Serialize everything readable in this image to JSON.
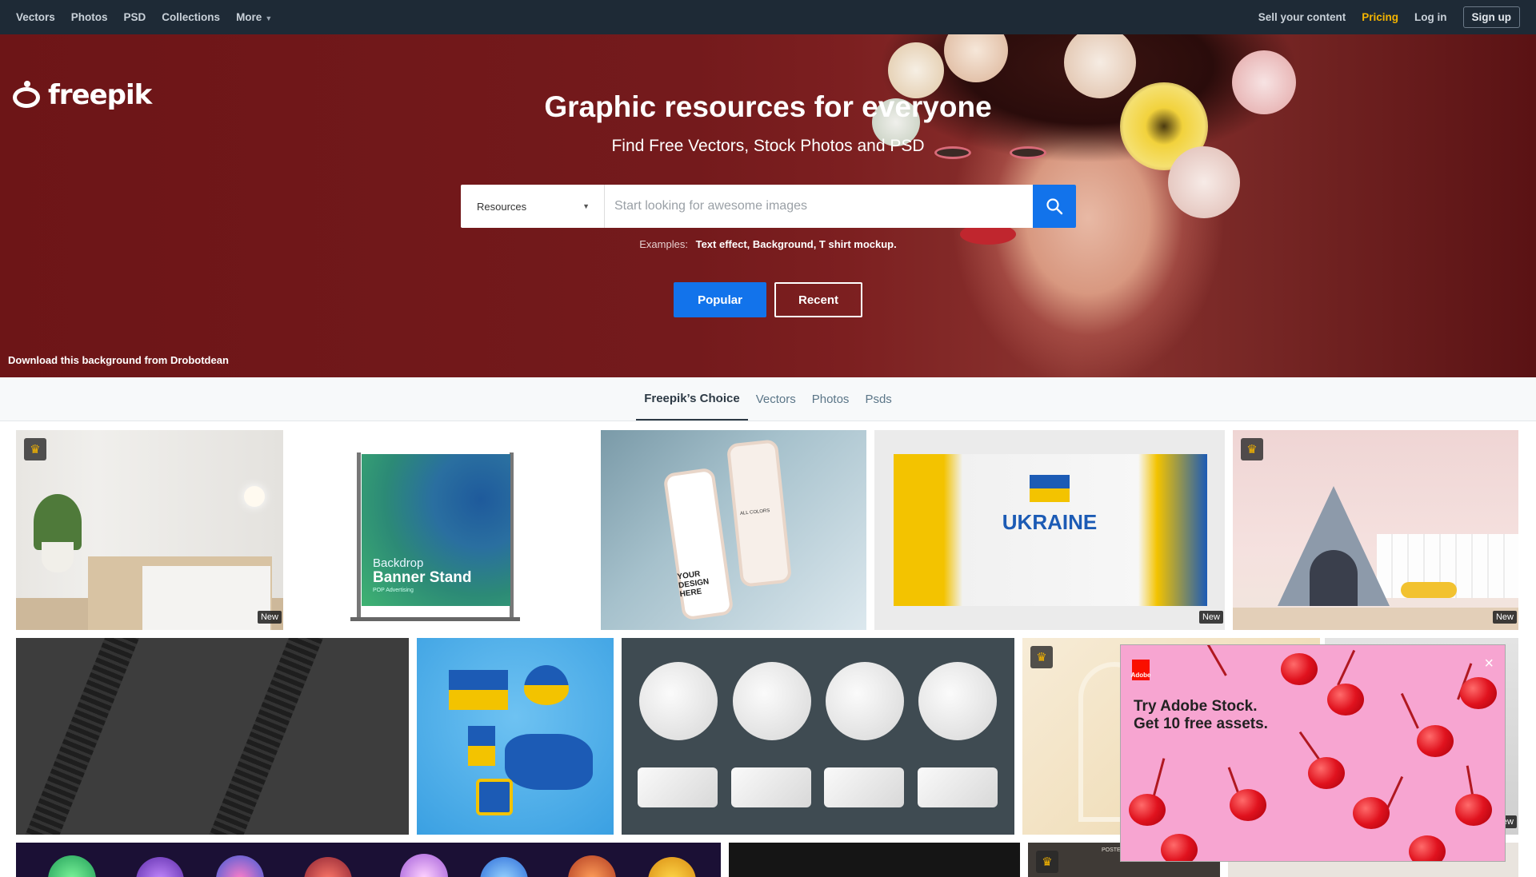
{
  "nav": {
    "left": [
      "Vectors",
      "Photos",
      "PSD",
      "Collections",
      "More"
    ],
    "sell": "Sell your content",
    "pricing": "Pricing",
    "login": "Log in",
    "signup": "Sign up"
  },
  "logo": {
    "text": "freepik"
  },
  "hero": {
    "title": "Graphic resources for everyone",
    "subtitle": "Find Free Vectors, Stock Photos and PSD",
    "search_type": "Resources",
    "search_placeholder": "Start looking for awesome images",
    "examples_label": "Examples:",
    "examples": "Text effect, Background, T shirt mockup.",
    "popular": "Popular",
    "recent": "Recent",
    "credit": "Download this background from Drobotdean"
  },
  "tabs": [
    "Freepik’s Choice",
    "Vectors",
    "Photos",
    "Psds"
  ],
  "thumbs": {
    "new_label": "New",
    "banner_line1": "Backdrop",
    "banner_line2": "Banner Stand",
    "banner_line3": "POP Advertising",
    "phone_text": "YOUR DESIGN HERE",
    "phone_small": "ALL COLORS",
    "ukraine": "UKRAINE",
    "poster_label": "POSTER"
  },
  "ad": {
    "brand": "Adobe",
    "line1": "Try Adobe Stock.",
    "line2": "Get 10 free assets.",
    "close": "×"
  },
  "colors": {
    "accent": "#1273eb",
    "pricing": "#f4b400",
    "nav_bg": "#1e2a36",
    "hero_bg": "#741a1c"
  }
}
